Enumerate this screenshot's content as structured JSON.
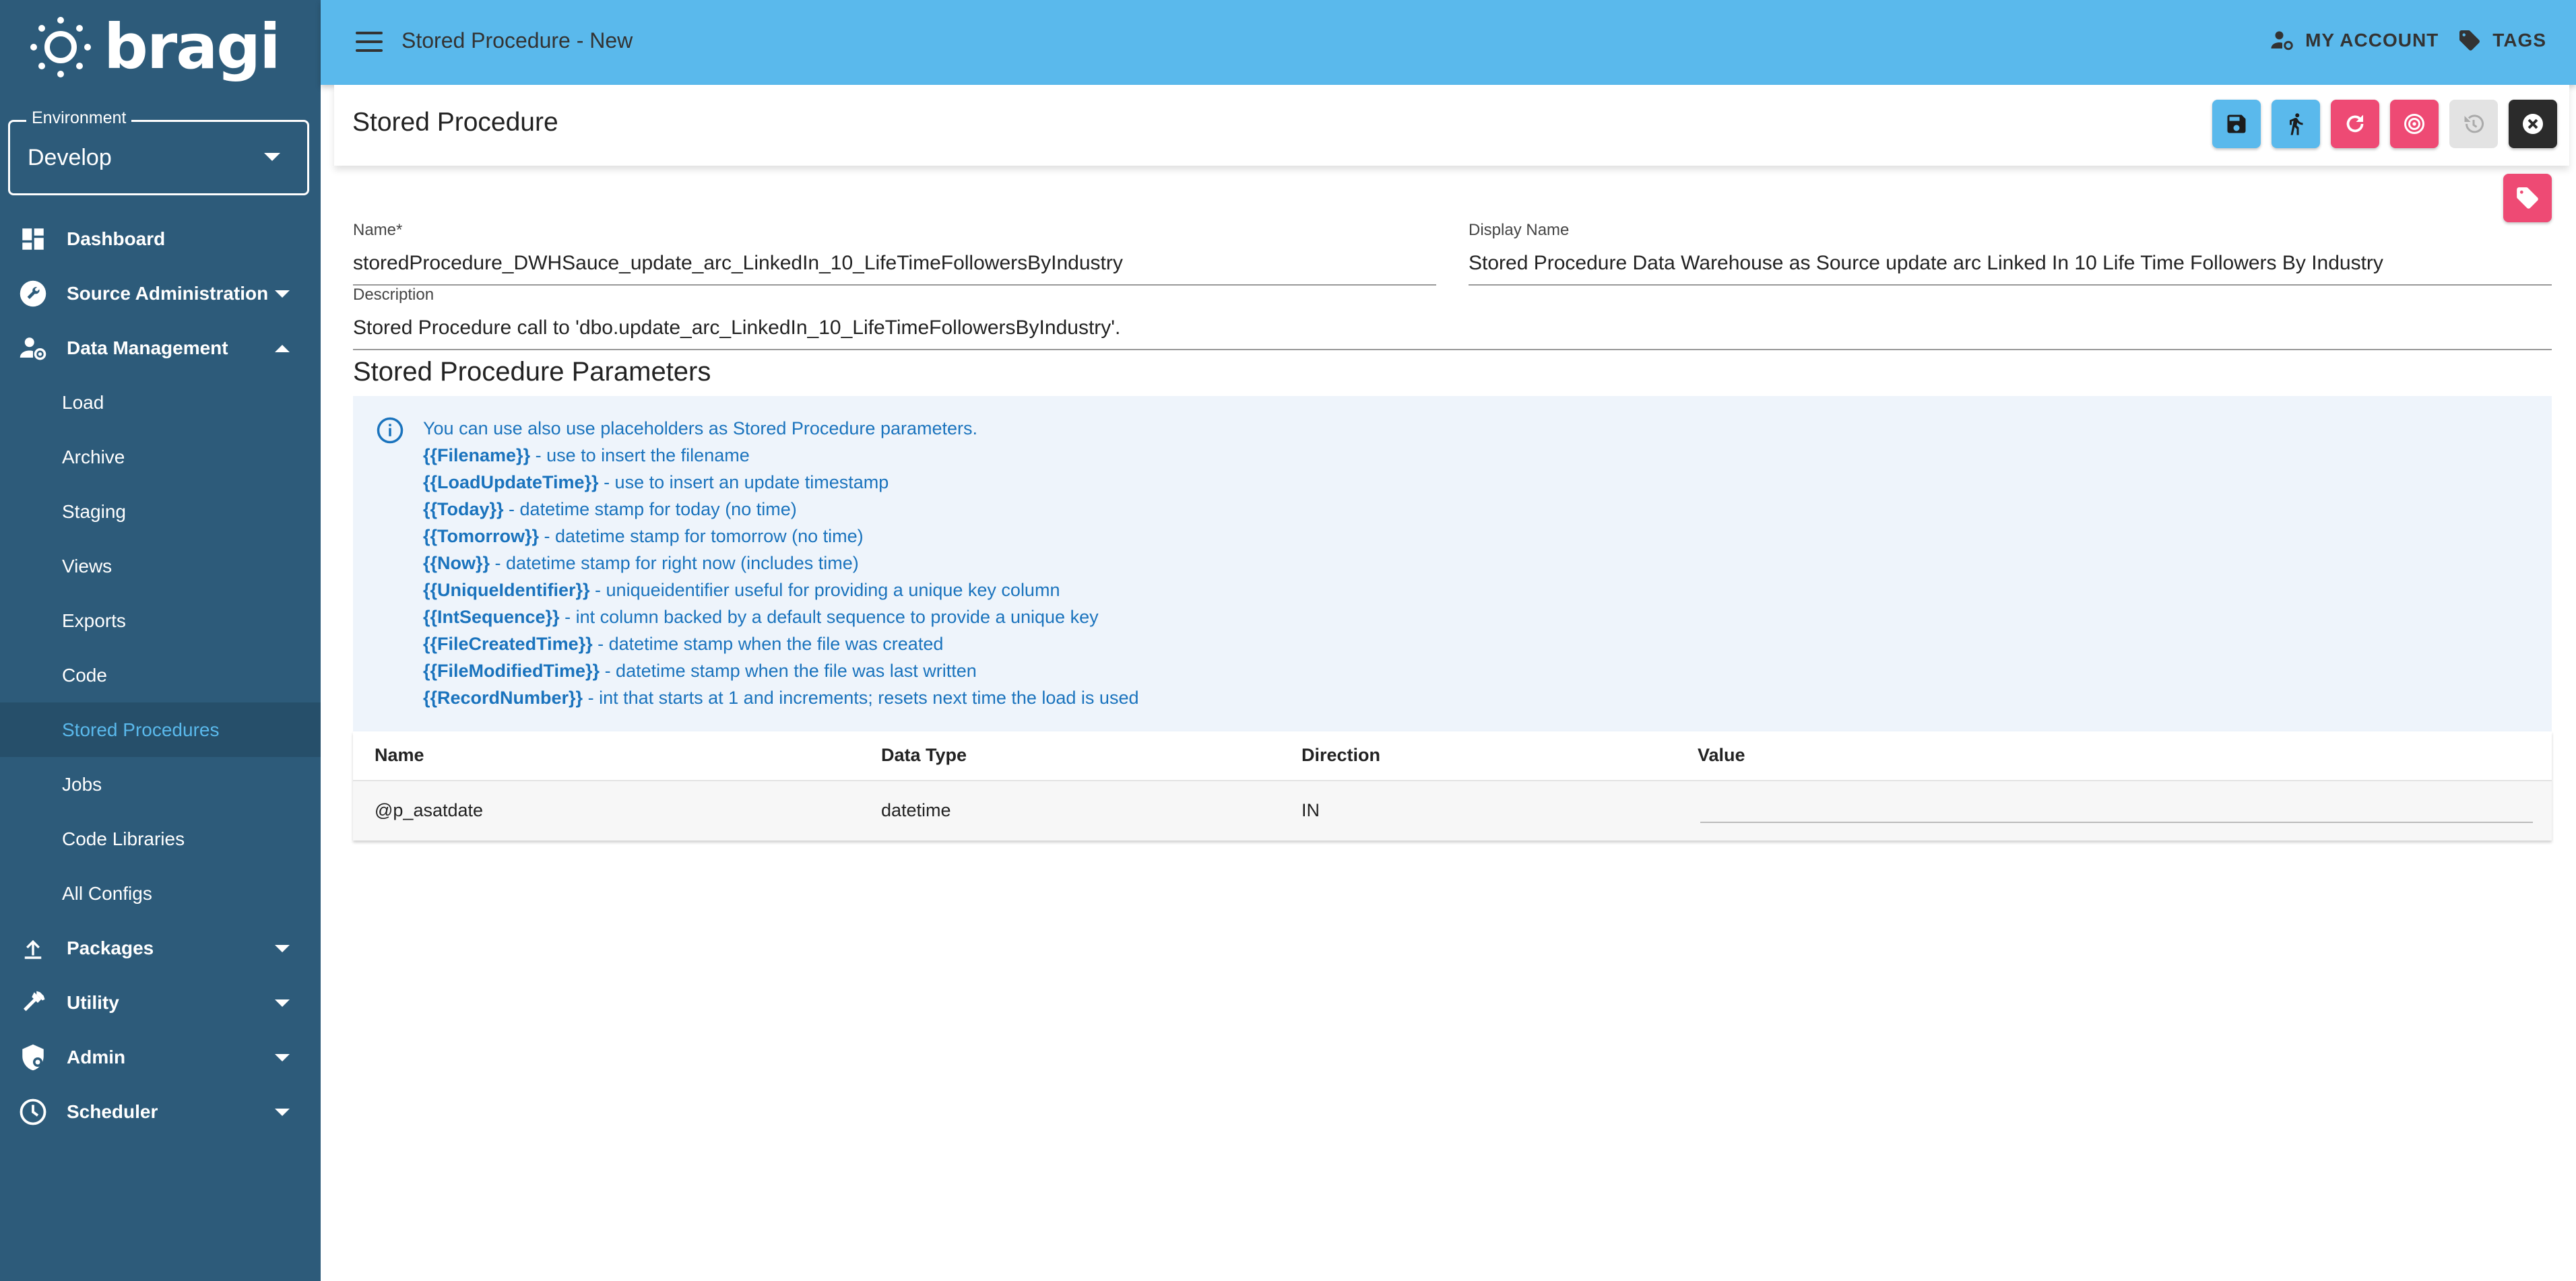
{
  "app": {
    "logo_text": "bragi"
  },
  "environment": {
    "label": "Environment",
    "value": "Develop"
  },
  "sidebar": {
    "items": [
      {
        "label": "Dashboard",
        "icon": "dashboard-icon"
      },
      {
        "label": "Source Administration",
        "icon": "wrench-icon"
      },
      {
        "label": "Data Management",
        "icon": "user-gear-icon"
      },
      {
        "label": "Load"
      },
      {
        "label": "Archive"
      },
      {
        "label": "Staging"
      },
      {
        "label": "Views"
      },
      {
        "label": "Exports"
      },
      {
        "label": "Code"
      },
      {
        "label": "Stored Procedures"
      },
      {
        "label": "Jobs"
      },
      {
        "label": "Code Libraries"
      },
      {
        "label": "All Configs"
      },
      {
        "label": "Packages",
        "icon": "upload-icon"
      },
      {
        "label": "Utility",
        "icon": "hammer-icon"
      },
      {
        "label": "Admin",
        "icon": "shield-gear-icon"
      },
      {
        "label": "Scheduler",
        "icon": "clock-icon"
      }
    ]
  },
  "header": {
    "title": "Stored Procedure - New",
    "my_account": "MY ACCOUNT",
    "tags": "TAGS"
  },
  "panel": {
    "title": "Stored Procedure"
  },
  "form": {
    "name_label": "Name*",
    "name_value": "storedProcedure_DWHSauce_update_arc_LinkedIn_10_LifeTimeFollowersByIndustry",
    "display_label": "Display Name",
    "display_value": "Stored Procedure Data Warehouse as Source update arc Linked In 10 Life Time Followers By Industry",
    "description_label": "Description",
    "description_value": "Stored Procedure call to 'dbo.update_arc_LinkedIn_10_LifeTimeFollowersByIndustry'."
  },
  "params": {
    "title": "Stored Procedure Parameters",
    "intro": "You can use also use placeholders as Stored Procedure parameters.",
    "placeholders": [
      {
        "key": "{{Filename}}",
        "desc": " - use to insert the filename"
      },
      {
        "key": "{{LoadUpdateTime}}",
        "desc": " - use to insert an update timestamp"
      },
      {
        "key": "{{Today}}",
        "desc": " - datetime stamp for today (no time)"
      },
      {
        "key": "{{Tomorrow}}",
        "desc": " - datetime stamp for tomorrow (no time)"
      },
      {
        "key": "{{Now}}",
        "desc": " - datetime stamp for right now (includes time)"
      },
      {
        "key": "{{UniqueIdentifier}}",
        "desc": " - uniqueidentifier useful for providing a unique key column"
      },
      {
        "key": "{{IntSequence}}",
        "desc": " - int column backed by a default sequence to provide a unique key"
      },
      {
        "key": "{{FileCreatedTime}}",
        "desc": " - datetime stamp when the file was created"
      },
      {
        "key": "{{FileModifiedTime}}",
        "desc": " - datetime stamp when the file was last written"
      },
      {
        "key": "{{RecordNumber}}",
        "desc": " - int that starts at 1 and increments; resets next time the load is used"
      }
    ],
    "columns": [
      "Name",
      "Data Type",
      "Direction",
      "Value"
    ],
    "rows": [
      {
        "name": "@p_asatdate",
        "type": "datetime",
        "direction": "IN",
        "value": ""
      }
    ]
  },
  "colors": {
    "sidebar": "#2d5b7a",
    "header": "#5ab9ec",
    "accent_pink": "#ee4a74",
    "active_link": "#5ab9ec",
    "info_text": "#1a73bd"
  }
}
